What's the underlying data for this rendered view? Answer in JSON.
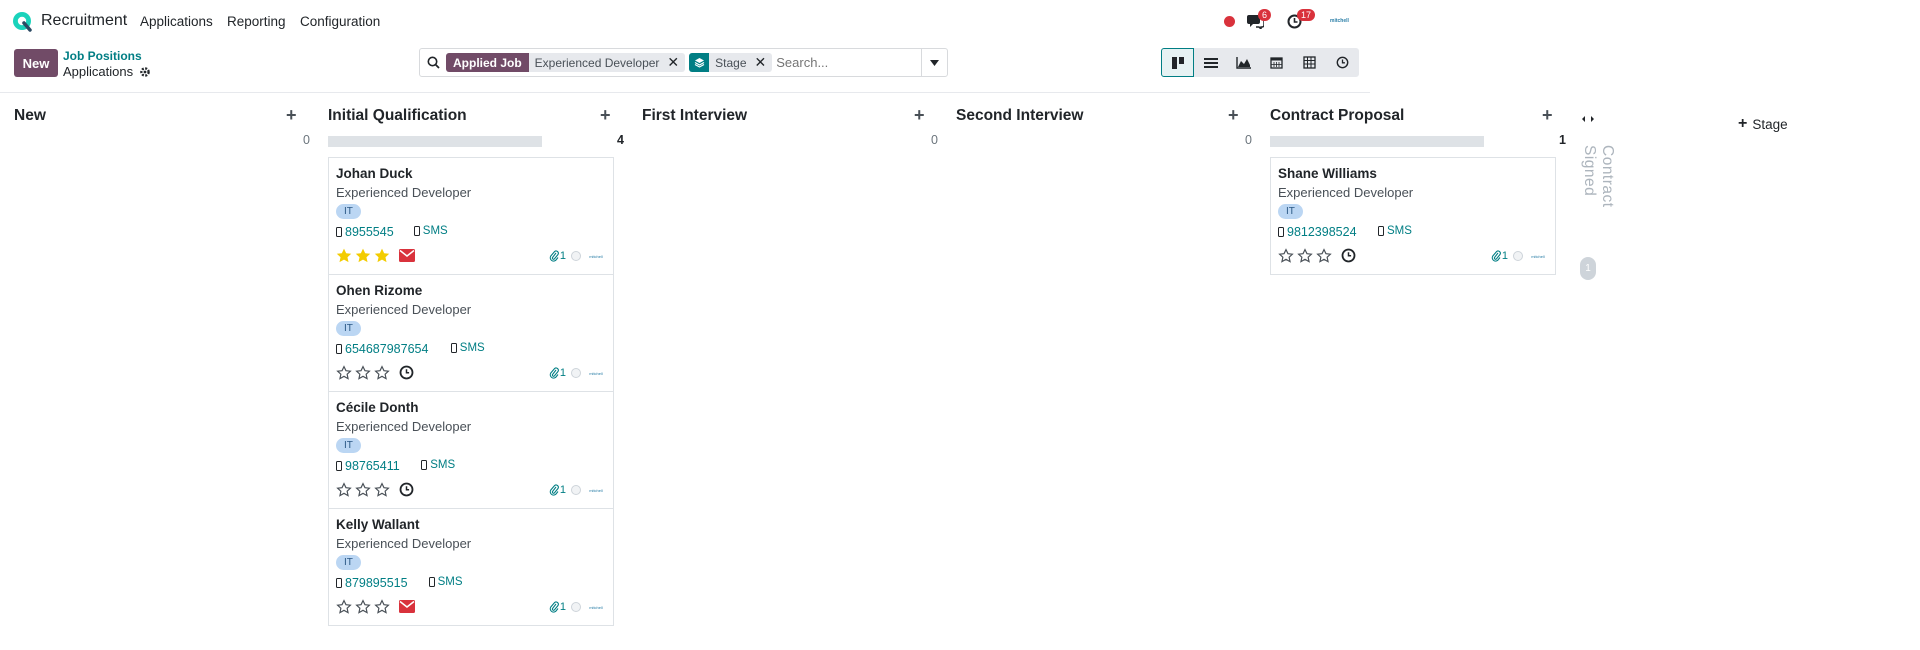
{
  "app": {
    "name": "Recruitment"
  },
  "nav": {
    "menus": [
      "Applications",
      "Reporting",
      "Configuration"
    ],
    "messages_count": "6",
    "activities_count": "17",
    "avatar_text": "mitchell"
  },
  "control": {
    "new_label": "New",
    "breadcrumb_parent": "Job Positions",
    "breadcrumb_current": "Applications"
  },
  "search": {
    "facets": [
      {
        "label": "Applied Job",
        "value": "Experienced Developer"
      },
      {
        "value": "Stage"
      }
    ],
    "placeholder": "Search..."
  },
  "views": [
    "kanban",
    "list",
    "graph",
    "calendar",
    "pivot",
    "activity"
  ],
  "columns": [
    {
      "title": "New",
      "count": "0"
    },
    {
      "title": "Initial Qualification",
      "count": "4"
    },
    {
      "title": "First Interview",
      "count": "0"
    },
    {
      "title": "Second Interview",
      "count": "0"
    },
    {
      "title": "Contract Proposal",
      "count": "1"
    }
  ],
  "cards": [
    {
      "name": "Johan Duck",
      "job": "Experienced Developer",
      "tag": "IT",
      "phone": "8955545",
      "sms": "SMS",
      "stars": 3,
      "activity": "email",
      "attachments": "1"
    },
    {
      "name": "Ohen Rizome",
      "job": "Experienced Developer",
      "tag": "IT",
      "phone": "654687987654",
      "sms": "SMS",
      "stars": 0,
      "activity": "clock",
      "attachments": "1"
    },
    {
      "name": "Cécile Donth",
      "job": "Experienced Developer",
      "tag": "IT",
      "phone": "98765411",
      "sms": "SMS",
      "stars": 0,
      "activity": "clock",
      "attachments": "1"
    },
    {
      "name": "Kelly Wallant",
      "job": "Experienced Developer",
      "tag": "IT",
      "phone": "879895515",
      "sms": "SMS",
      "stars": 0,
      "activity": "email",
      "attachments": "1"
    },
    {
      "name": "Shane Williams",
      "job": "Experienced Developer",
      "tag": "IT",
      "phone": "9812398524",
      "sms": "SMS",
      "stars": 0,
      "activity": "clock",
      "attachments": "1"
    }
  ],
  "folded_column": {
    "title": "Contract Signed",
    "count": "1"
  },
  "add_stage_label": "Stage",
  "colors": {
    "brand": "#714b67",
    "accent": "#017e84",
    "star": "#f3cc00",
    "danger": "#d9323c"
  }
}
